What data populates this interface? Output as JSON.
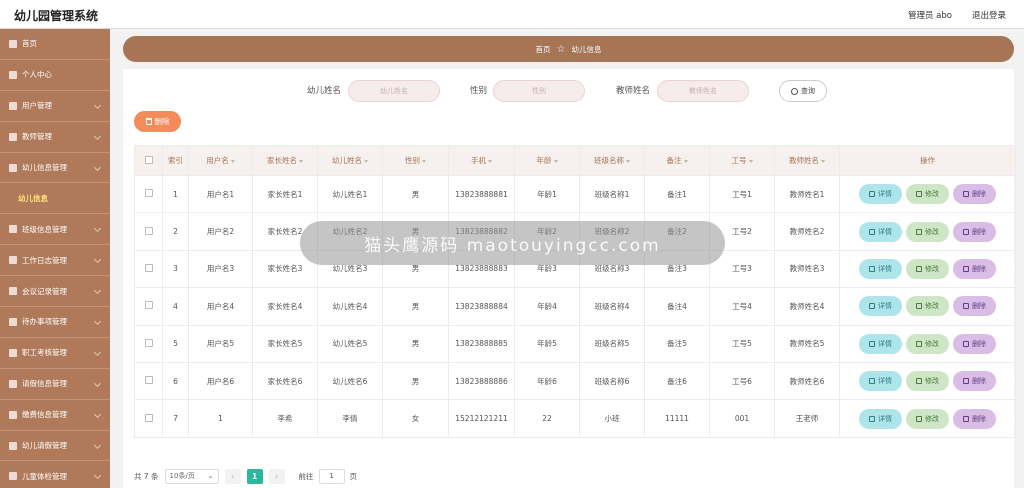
{
  "app": {
    "title": "幼儿园管理系统",
    "admin": "管理员 abo",
    "logout": "退出登录"
  },
  "sidebar": {
    "items": [
      {
        "label": "首页",
        "icon": "home-icon"
      },
      {
        "label": "个人中心",
        "icon": "user-icon"
      },
      {
        "label": "用户管理",
        "icon": "users-icon"
      },
      {
        "label": "教师管理",
        "icon": "teacher-icon"
      },
      {
        "label": "幼儿信息管理",
        "icon": "child-icon"
      },
      {
        "label": "幼儿信息",
        "sub": true
      },
      {
        "label": "班级信息管理",
        "icon": "class-icon"
      },
      {
        "label": "工作日志管理",
        "icon": "log-icon"
      },
      {
        "label": "会议记录管理",
        "icon": "meeting-icon"
      },
      {
        "label": "待办事项管理",
        "icon": "todo-icon"
      },
      {
        "label": "职工考核管理",
        "icon": "assess-icon"
      },
      {
        "label": "请假信息管理",
        "icon": "leave-icon"
      },
      {
        "label": "缴费信息管理",
        "icon": "fee-icon"
      },
      {
        "label": "幼儿请假管理",
        "icon": "child-leave-icon"
      },
      {
        "label": "儿童体检管理",
        "icon": "health-icon"
      }
    ]
  },
  "breadcrumb": {
    "home": "首页",
    "current": "幼儿信息"
  },
  "search": {
    "child_label": "幼儿姓名",
    "child_placeholder": "幼儿姓名",
    "gender_label": "性别",
    "gender_placeholder": "性别",
    "teacher_label": "教师姓名",
    "teacher_placeholder": "教师姓名",
    "button": "查询"
  },
  "toolbar": {
    "delete": "删除"
  },
  "table": {
    "headers": [
      "索引",
      "用户名",
      "家长姓名",
      "幼儿姓名",
      "性别",
      "手机",
      "年龄",
      "班级名称",
      "备注",
      "工号",
      "教师姓名",
      "操作"
    ],
    "rows": [
      [
        "1",
        "用户名1",
        "家长姓名1",
        "幼儿姓名1",
        "男",
        "13823888881",
        "年龄1",
        "班级名称1",
        "备注1",
        "工号1",
        "教师姓名1"
      ],
      [
        "2",
        "用户名2",
        "家长姓名2",
        "幼儿姓名2",
        "男",
        "13823888882",
        "年龄2",
        "班级名称2",
        "备注2",
        "工号2",
        "教师姓名2"
      ],
      [
        "3",
        "用户名3",
        "家长姓名3",
        "幼儿姓名3",
        "男",
        "13823888883",
        "年龄3",
        "班级名称3",
        "备注3",
        "工号3",
        "教师姓名3"
      ],
      [
        "4",
        "用户名4",
        "家长姓名4",
        "幼儿姓名4",
        "男",
        "13823888884",
        "年龄4",
        "班级名称4",
        "备注4",
        "工号4",
        "教师姓名4"
      ],
      [
        "5",
        "用户名5",
        "家长姓名5",
        "幼儿姓名5",
        "男",
        "13823888885",
        "年龄5",
        "班级名称5",
        "备注5",
        "工号5",
        "教师姓名5"
      ],
      [
        "6",
        "用户名6",
        "家长姓名6",
        "幼儿姓名6",
        "男",
        "13823888886",
        "年龄6",
        "班级名称6",
        "备注6",
        "工号6",
        "教师姓名6"
      ],
      [
        "7",
        "1",
        "李希",
        "李倩",
        "女",
        "15212121211",
        "22",
        "小班",
        "11111",
        "001",
        "王老师"
      ]
    ],
    "actions": {
      "detail": "详情",
      "edit": "修改",
      "delete": "删除"
    }
  },
  "pagination": {
    "total": "共 7 条",
    "page_size": "10条/页",
    "current": "1",
    "goto": "前往",
    "goto_value": "1",
    "page_unit": "页"
  },
  "watermark": "猫头鹰源码 maotouyingcc.com",
  "colors": {
    "sidebar": "#b07a5a",
    "accent": "#a57556",
    "delete": "#f38b5a",
    "page_active": "#28b89e"
  }
}
